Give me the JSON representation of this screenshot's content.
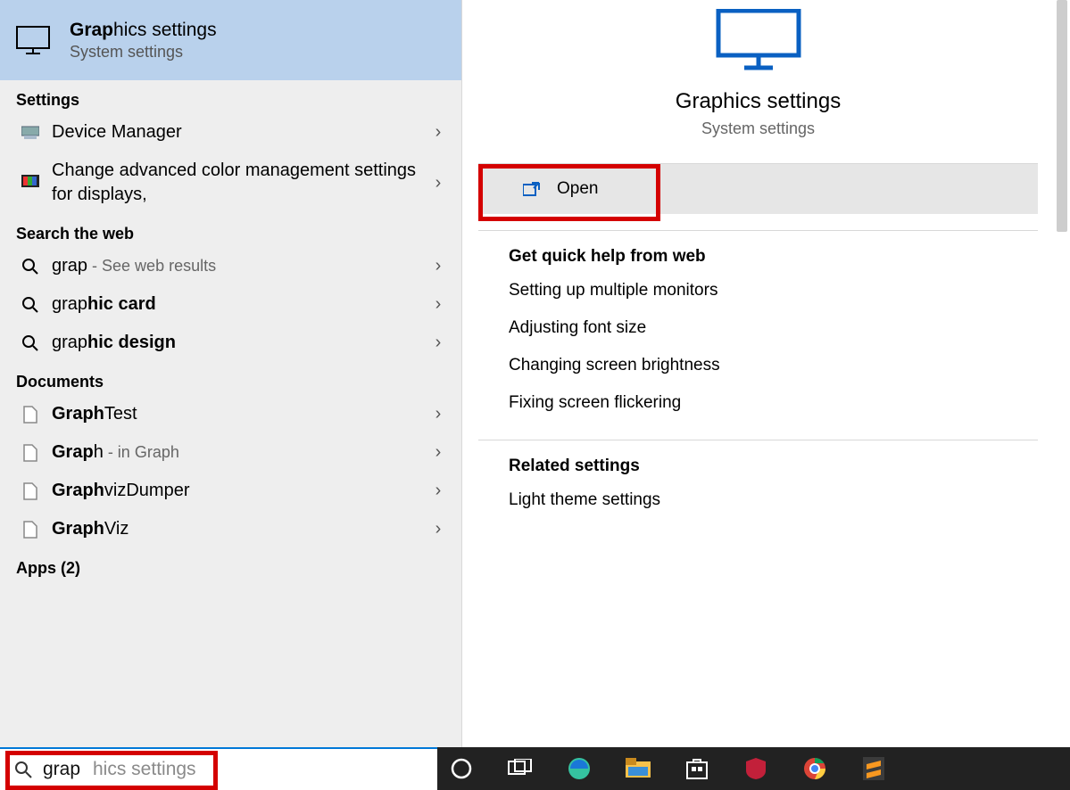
{
  "best_match": {
    "title_bold": "Grap",
    "title_rest": "hics settings",
    "subtitle": "System settings"
  },
  "sections": {
    "settings_header": "Settings",
    "settings_items": [
      {
        "label": "Device Manager"
      },
      {
        "label": "Change advanced color management settings for displays,"
      }
    ],
    "web_header": "Search the web",
    "web_items": [
      {
        "prefix": "grap",
        "bold": "",
        "suffix": " - See web results"
      },
      {
        "prefix": "grap",
        "bold": "hic card",
        "suffix": ""
      },
      {
        "prefix": "grap",
        "bold": "hic design",
        "suffix": ""
      }
    ],
    "docs_header": "Documents",
    "docs_items": [
      {
        "bold": "Graph",
        "rest": "Test",
        "suffix": ""
      },
      {
        "bold": "Grap",
        "rest": "h",
        "suffix": " - in Graph"
      },
      {
        "bold": "Graph",
        "rest": "vizDumper",
        "suffix": ""
      },
      {
        "bold": "Graph",
        "rest": "Viz",
        "suffix": ""
      }
    ],
    "apps_header": "Apps (2)"
  },
  "preview": {
    "title": "Graphics settings",
    "subtitle": "System settings",
    "open_label": "Open",
    "help_header": "Get quick help from web",
    "help_links": [
      "Setting up multiple monitors",
      "Adjusting font size",
      "Changing screen brightness",
      "Fixing screen flickering"
    ],
    "related_header": "Related settings",
    "related_links": [
      "Light theme settings"
    ]
  },
  "search": {
    "typed": "grap",
    "ghost": "hics settings"
  },
  "taskbar_icons": [
    "cortana-icon",
    "task-view-icon",
    "edge-icon",
    "file-explorer-icon",
    "microsoft-store-icon",
    "mcafee-icon",
    "chrome-icon",
    "sublime-icon"
  ]
}
